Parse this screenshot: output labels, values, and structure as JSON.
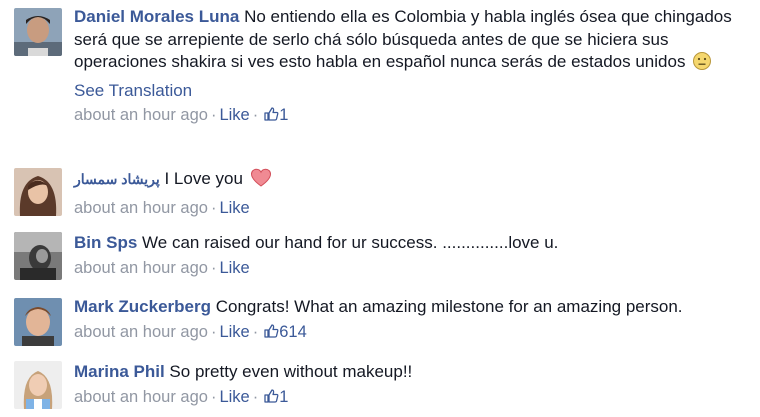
{
  "comments": [
    {
      "author": "Daniel Morales Luna",
      "text": "No entiendo ella es Colombia y habla inglés ósea que chingados será que se arrepiente de serlo chá sólo búsqueda antes de que se hiciera sus operaciones shakira si ves esto habla en español nunca serás de estados unidos",
      "emoji": "confused-face-icon",
      "translation_link": "See Translation",
      "timestamp": "about an hour ago",
      "like_label": "Like",
      "like_count": "1"
    },
    {
      "author": "پریشاد سمسار",
      "text": "I Love you",
      "emoji": "heart-icon",
      "timestamp": "about an hour ago",
      "like_label": "Like"
    },
    {
      "author": "Bin Sps",
      "text": "We can raised our hand for ur success. ..............love u.",
      "timestamp": "about an hour ago",
      "like_label": "Like"
    },
    {
      "author": "Mark Zuckerberg",
      "text": "Congrats! What an amazing milestone for an amazing person.",
      "timestamp": "about an hour ago",
      "like_label": "Like",
      "like_count": "614"
    },
    {
      "author": "Marina Phil",
      "text": "So pretty even without makeup!!",
      "timestamp": "about an hour ago",
      "like_label": "Like",
      "like_count": "1"
    }
  ],
  "colors": {
    "link": "#3b5998",
    "meta": "#9197a3",
    "text": "#141823",
    "heart": "#e0535d"
  }
}
